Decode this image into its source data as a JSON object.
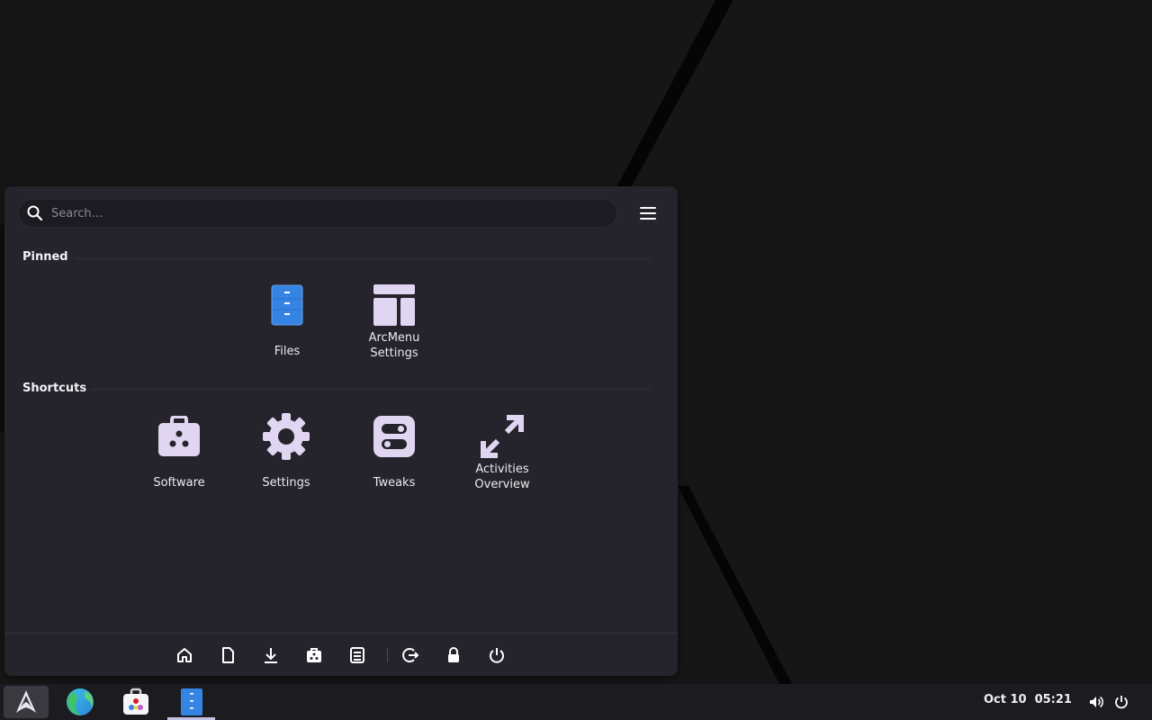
{
  "search": {
    "placeholder": "Search…"
  },
  "pinned": {
    "title": "Pinned",
    "items": [
      {
        "label": "Files",
        "icon": "files-icon"
      },
      {
        "label": "ArcMenu\nSettings",
        "label_line1": "ArcMenu",
        "label_line2": "Settings",
        "icon": "arcmenu-settings-icon"
      }
    ]
  },
  "shortcuts": {
    "title": "Shortcuts",
    "items": [
      {
        "label": "Software",
        "icon": "software-icon"
      },
      {
        "label": "Settings",
        "icon": "settings-gear-icon"
      },
      {
        "label": "Tweaks",
        "icon": "tweaks-icon"
      },
      {
        "label_line1": "Activities",
        "label_line2": "Overview",
        "icon": "activities-overview-icon"
      }
    ]
  },
  "bottom_bar": {
    "buttons": [
      "home-icon",
      "documents-icon",
      "downloads-icon",
      "software-icon",
      "files-icon",
      "logout-icon",
      "lock-icon",
      "power-icon"
    ]
  },
  "taskbar": {
    "apps": [
      "arch-logo-icon",
      "browser-icon",
      "software-icon",
      "files-icon"
    ],
    "date": "Oct 10",
    "time": "05:21"
  },
  "colors": {
    "accent": "#c5c0e6",
    "icon_lavender": "#e0d6f2",
    "files_blue": "#3584e4",
    "menu_bg": "#25232b"
  }
}
